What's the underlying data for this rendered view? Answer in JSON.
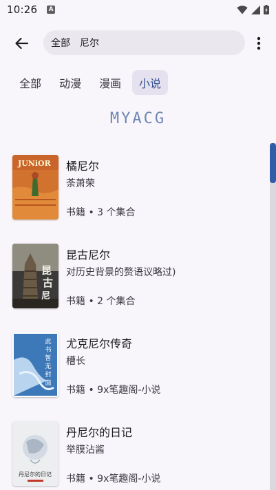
{
  "status_bar": {
    "time": "10:26",
    "notification_icon": "A"
  },
  "toolbar": {
    "scope": "全部",
    "query": "尼尔"
  },
  "tabs": [
    {
      "label": "全部",
      "active": false
    },
    {
      "label": "动漫",
      "active": false
    },
    {
      "label": "漫画",
      "active": false
    },
    {
      "label": "小说",
      "active": true
    }
  ],
  "source_logo": "MYACG",
  "books": [
    {
      "title": "橘尼尔",
      "author": "荼萧荣",
      "meta": "书籍 • 3 个集合"
    },
    {
      "title": "昆古尼尔",
      "author": "对历史背景的赘语议略过)",
      "meta": "书籍 • 2 个集合"
    },
    {
      "title": "尤克尼尔传奇",
      "author": "槽长",
      "meta": "书籍 • 9x笔趣阁-小说"
    },
    {
      "title": "丹尼尔的日记",
      "author": "举膜沾酱",
      "meta": "书籍 • 9x笔趣阁-小说"
    }
  ],
  "covers": [
    {
      "text": "JUNiOR",
      "bg": "#d2722f"
    },
    {
      "text": "昆古尼尔",
      "bg": "#3b3a38"
    },
    {
      "text": "此书暂无封面",
      "bg": "#3d78b8"
    },
    {
      "text": "丹尼尔的日记",
      "bg": "#eceef0"
    }
  ],
  "colors": {
    "accent": "#2f5da8",
    "background": "#f8f5fb",
    "search_bg": "#ebe7ee",
    "active_tab_bg": "#e6e1ee"
  }
}
